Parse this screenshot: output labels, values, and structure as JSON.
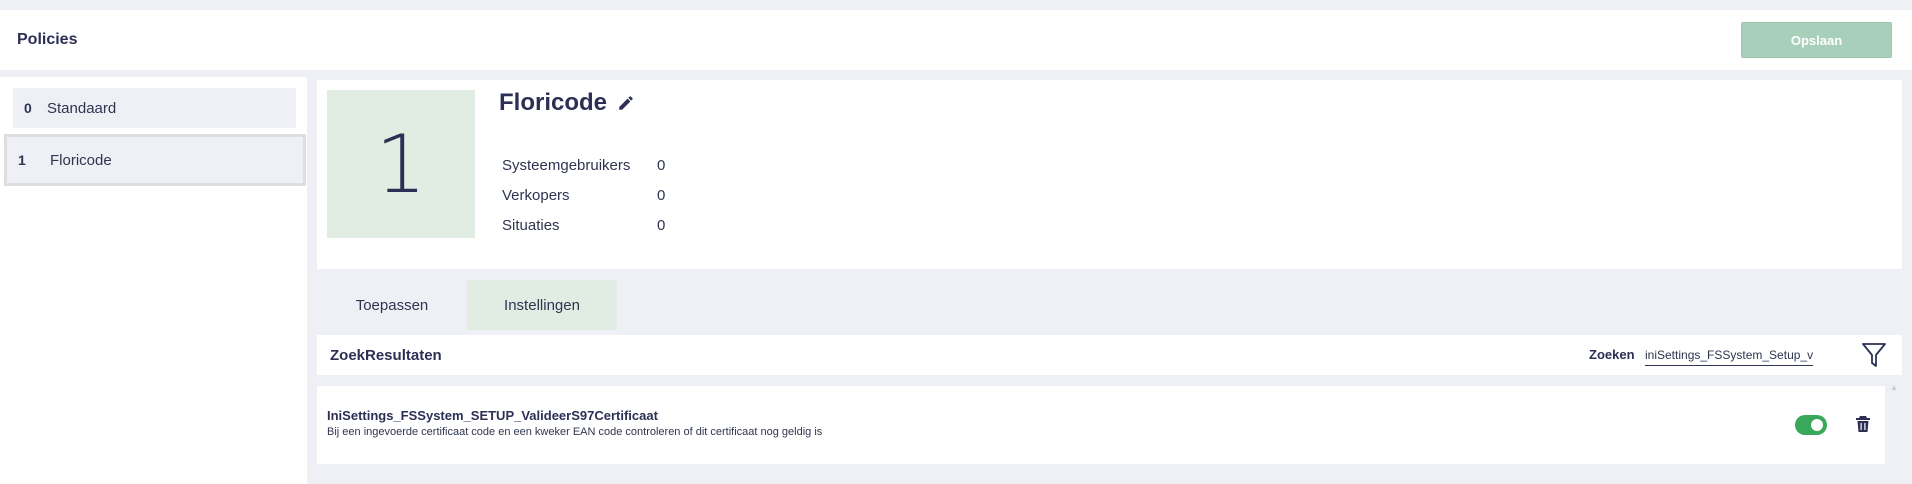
{
  "header": {
    "title": "Policies",
    "save_label": "Opslaan"
  },
  "sidebar": {
    "items": [
      {
        "num": "0",
        "label": "Standaard"
      },
      {
        "num": "1",
        "label": "Floricode"
      }
    ]
  },
  "detail": {
    "number": "1",
    "name": "Floricode",
    "stats": [
      {
        "label": "Systeemgebruikers",
        "value": "0"
      },
      {
        "label": "Verkopers",
        "value": "0"
      },
      {
        "label": "Situaties",
        "value": "0"
      }
    ]
  },
  "tabs": [
    {
      "label": "Toepassen"
    },
    {
      "label": "Instellingen"
    }
  ],
  "results": {
    "heading": "ZoekResultaten",
    "search_label": "Zoeken",
    "search_value": "iniSettings_FSSystem_Setup_valideerS"
  },
  "items": [
    {
      "title": "IniSettings_FSSystem_SETUP_ValideerS97Certificaat",
      "description": "Bij een ingevoerde certificaat code en een kweker EAN code controleren of dit certificaat nog geldig is",
      "enabled": true
    }
  ],
  "colors": {
    "accent_green": "#3aa85a",
    "save_button": "#a8cfba",
    "active_tab": "#e1ede3",
    "text_dark": "#2d2f55"
  }
}
